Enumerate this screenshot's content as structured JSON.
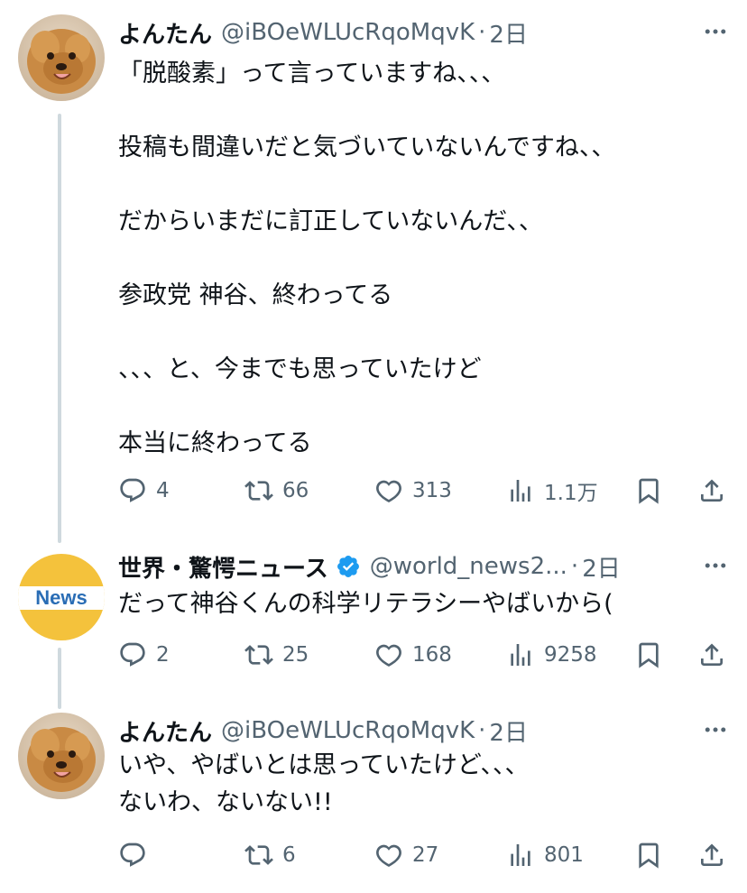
{
  "tweets": [
    {
      "name": "よんたん",
      "handle": "@iBOeWLUcRqoMqvK",
      "time": "2日",
      "text": "「脱酸素」って言っていますね、、、\n\n投稿も間違いだと気づいていないんですね、、\n\nだからいまだに訂正していないんだ、、\n\n参政党 神谷、終わってる\n\n、、、と、今までも思っていたけど\n\n本当に終わってる",
      "replies": "4",
      "retweets": "66",
      "likes": "313",
      "views": "1.1万"
    },
    {
      "name": "世界・驚愕ニュース",
      "handle": "@world_news2...",
      "time": "2日",
      "verified": true,
      "avatar_text": "News",
      "text": "だって神谷くんの科学リテラシーやばいから(",
      "replies": "2",
      "retweets": "25",
      "likes": "168",
      "views": "9258"
    },
    {
      "name": "よんたん",
      "handle": "@iBOeWLUcRqoMqvK",
      "time": "2日",
      "text": "いや、やばいとは思っていたけど、、、\nないわ、ないない!!",
      "replies": "",
      "retweets": "6",
      "likes": "27",
      "views": "801"
    }
  ],
  "colors": {
    "text": "#0f1419",
    "secondary": "#536471",
    "thread_line": "#cfd9de",
    "verified": "#1d9bf0",
    "news_avatar_bg": "#f4c23c"
  },
  "icons": [
    "reply-icon",
    "retweet-icon",
    "like-icon",
    "views-icon",
    "bookmark-icon",
    "share-icon",
    "more-icon",
    "verified-icon"
  ]
}
